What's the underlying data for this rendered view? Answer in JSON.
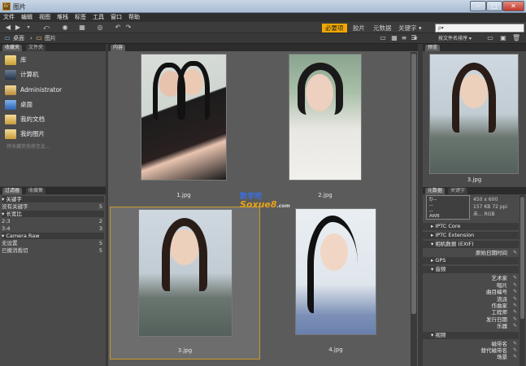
{
  "window": {
    "title": "图片",
    "min": "–",
    "max": "□",
    "close": "✕"
  },
  "menu": [
    "文件",
    "编辑",
    "视图",
    "堆栈",
    "标签",
    "工具",
    "窗口",
    "帮助"
  ],
  "workspaces": [
    "必要项",
    "胶片",
    "元数据",
    "关键字 ▾"
  ],
  "search": {
    "placeholder": "ρ▾"
  },
  "breadcrumb": {
    "root": "桌面",
    "sep": "›",
    "current": "图片"
  },
  "toolbar2": {
    "sort_label": "按文件名排序 ▾"
  },
  "left_panel": {
    "tabs": [
      "收藏夹",
      "文件夹"
    ],
    "favorites": [
      "库",
      "计算机",
      "Administrator",
      "桌面",
      "我的文档",
      "我的图片"
    ],
    "drag_hint": "将收藏夹拖移至此...",
    "filter_tabs": [
      "过滤器",
      "收藏集"
    ],
    "filter_rows": [
      {
        "label": "▾ 关键字",
        "count": "",
        "hdr": true
      },
      {
        "label": "没有关键字",
        "count": "5",
        "hdr": false
      },
      {
        "label": "▾ 长宽比",
        "count": "",
        "hdr": true
      },
      {
        "label": "2:3",
        "count": "2",
        "hdr": false
      },
      {
        "label": "3:4",
        "count": "3",
        "hdr": false
      },
      {
        "label": "▾ Camera Raw",
        "count": "",
        "hdr": true
      },
      {
        "label": "无设置",
        "count": "5",
        "hdr": false
      },
      {
        "label": "已撤消裁切",
        "count": "5",
        "hdr": false
      }
    ]
  },
  "content": {
    "tab": "内容",
    "thumbnails": [
      {
        "name": "1.jpg"
      },
      {
        "name": "2.jpg"
      },
      {
        "name": "3.jpg"
      },
      {
        "name": "4.jpg"
      }
    ],
    "watermark": {
      "line1": "数学吧",
      "line2": "Soxue8",
      "line3": ".com"
    }
  },
  "right_panel": {
    "preview_tab": "预览",
    "preview_caption": "3.jpg",
    "meta_tabs": [
      "元数据",
      "关键字"
    ],
    "camera_info": {
      "f": "f/--",
      "dash1": "--",
      "dash2": "--",
      "awb": "AWB",
      "dims": "450 x 600",
      "size": "157 KB  72 ppi",
      "misc": "未...",
      "mode": "RGB"
    },
    "sections": [
      "▸ IPTC Core",
      "▸ IPTC Extension",
      "▾ 相机数据 (EXIF)",
      "▸ GPS",
      "▾ 音频",
      "▾ 视频"
    ],
    "exif_rows": [
      "原始日期时间"
    ],
    "audio_rows": [
      "艺术家",
      "唱片",
      "曲目编号",
      "流派",
      "作曲家",
      "工程师",
      "发行日期",
      "乐器"
    ],
    "video_rows": [
      "磁带名",
      "替代磁带名",
      "场景"
    ]
  },
  "colors": {
    "accent": "#f0a800",
    "selection": "#c99a30"
  }
}
